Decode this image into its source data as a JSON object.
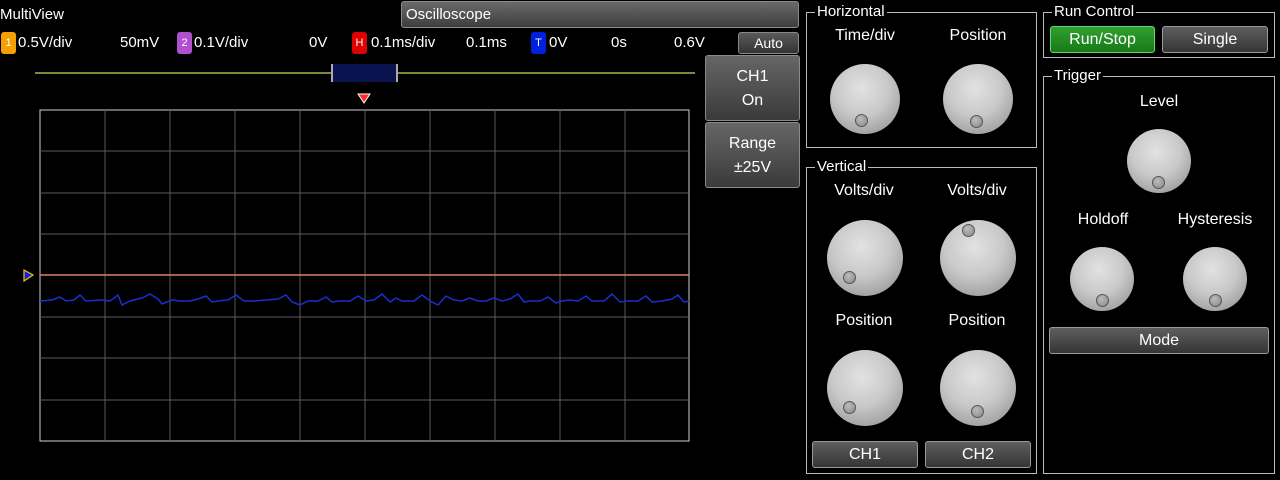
{
  "app_title": "MultiView",
  "mode_button_label": "Oscilloscope",
  "status": {
    "ch1_badge": "1",
    "ch1_scale": "0.5V/div",
    "ch1_offset": "50mV",
    "ch2_badge": "2",
    "ch2_scale": "0.1V/div",
    "ch2_offset": "0V",
    "horiz_badge": "H",
    "horiz_scale": "0.1ms/div",
    "horiz_position": "0.1ms",
    "trigger_badge": "T",
    "trigger_level": "0V",
    "trigger_time": "0s",
    "trigger_extra": "0.6V",
    "auto_label": "Auto"
  },
  "side_buttons": {
    "channel_line1": "CH1",
    "channel_line2": "On",
    "range_line1": "Range",
    "range_line2": "±25V"
  },
  "horizontal": {
    "title": "Horizontal",
    "time_div_label": "Time/div",
    "position_label": "Position"
  },
  "vertical": {
    "title": "Vertical",
    "ch1_volts_label": "Volts/div",
    "ch2_volts_label": "Volts/div",
    "ch1_position_label": "Position",
    "ch2_position_label": "Position",
    "ch1_button": "CH1",
    "ch2_button": "CH2"
  },
  "run_control": {
    "title": "Run Control",
    "run_stop_label": "Run/Stop",
    "single_label": "Single"
  },
  "trigger": {
    "title": "Trigger",
    "level_label": "Level",
    "holdoff_label": "Holdoff",
    "hysteresis_label": "Hysteresis",
    "mode_label": "Mode"
  },
  "colors": {
    "ch1": "#f5a000",
    "ch2": "#b050d0",
    "horizontal": "#e00000",
    "trigger": "#0020e0",
    "trace_ch1": "#e08060",
    "trace_ch2": "#1020c0",
    "run_active": "#22992a"
  }
}
